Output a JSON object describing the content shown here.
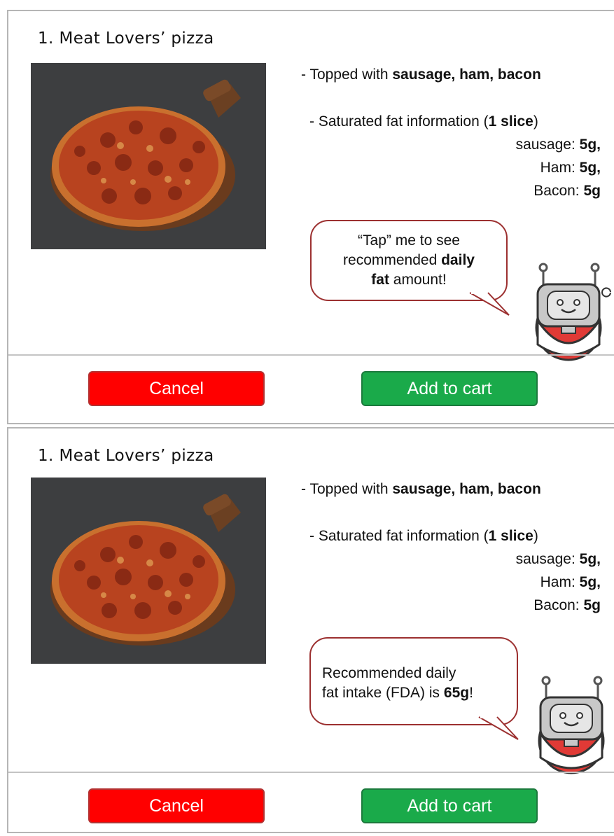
{
  "screens": [
    {
      "title": "1. Meat Lovers’ pizza",
      "topping_prefix": "- Topped with ",
      "topping_items": "sausage, ham, bacon",
      "sat_prefix": "- Saturated fat information (",
      "sat_slice": "1 slice",
      "sat_suffix": ")",
      "fat_rows": [
        {
          "label": "sausage: ",
          "value": "5g,"
        },
        {
          "label": "Ham: ",
          "value": "5g,"
        },
        {
          "label": "Bacon: ",
          "value": "5g"
        }
      ],
      "bubble": {
        "line1": "“Tap” me to see",
        "line2_prefix": "recommended ",
        "line2_bold": "daily",
        "line3_bold": "fat",
        "line3_suffix": " amount!"
      },
      "cancel_label": "Cancel",
      "add_label": "Add to cart"
    },
    {
      "title": "1. Meat Lovers’ pizza",
      "topping_prefix": "- Topped with ",
      "topping_items": "sausage, ham, bacon",
      "sat_prefix": "- Saturated fat information (",
      "sat_slice": "1 slice",
      "sat_suffix": ")",
      "fat_rows": [
        {
          "label": "sausage: ",
          "value": "5g,"
        },
        {
          "label": "Ham: ",
          "value": "5g,"
        },
        {
          "label": "Bacon: ",
          "value": "5g"
        }
      ],
      "bubble": {
        "line1": "Recommended daily",
        "line2_prefix": "fat intake (FDA) is ",
        "line2_bold": "65g",
        "line2_suffix": "!"
      },
      "cancel_label": "Cancel",
      "add_label": "Add to cart"
    }
  ],
  "colors": {
    "cancel": "#ff0000",
    "add_to_cart": "#1aaa4a",
    "bubble_border": "#9c3030",
    "robot_body": "#e03a36"
  }
}
